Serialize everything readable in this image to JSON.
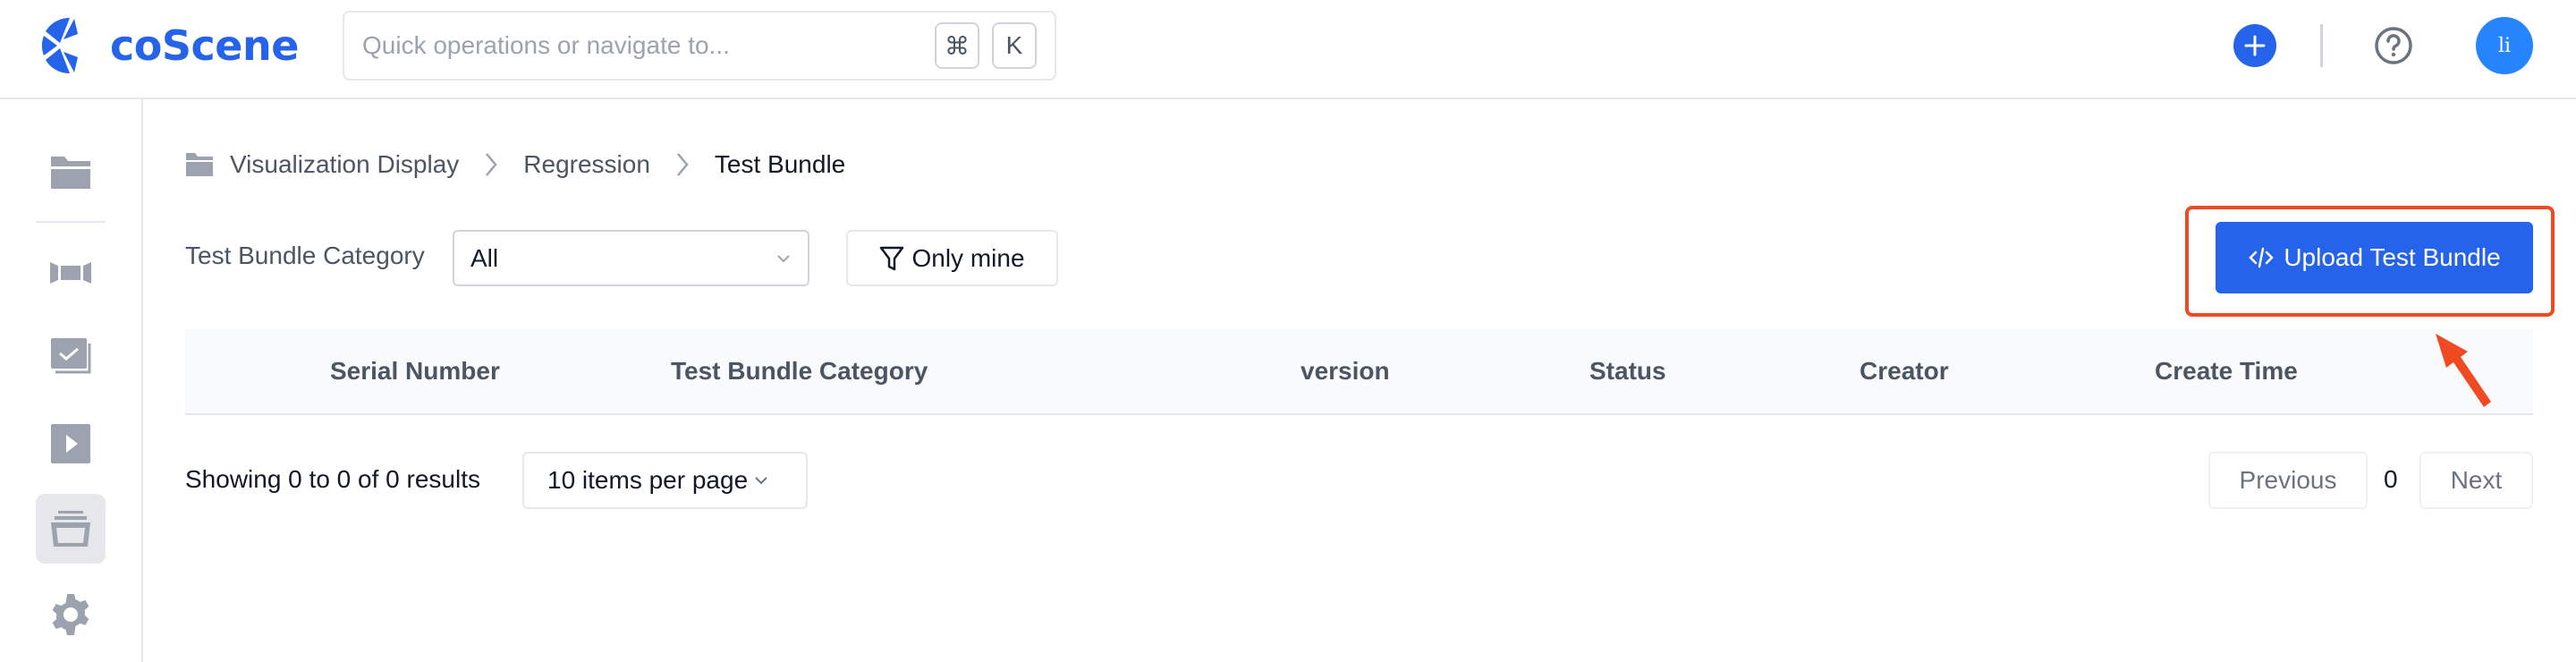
{
  "header": {
    "logo_text": "coScene",
    "search": {
      "placeholder": "Quick operations or navigate to...",
      "shortcut_keys": [
        "⌘",
        "K"
      ]
    },
    "avatar_initials": "li",
    "icons": {
      "create": "plus-icon",
      "help": "help-circle-icon"
    }
  },
  "sidebar": {
    "items": [
      {
        "name": "projects",
        "icon": "folder-icon",
        "active": false
      },
      {
        "name": "viz",
        "icon": "panorama-icon",
        "active": false
      },
      {
        "name": "tasks",
        "icon": "task-check-icon",
        "active": false
      },
      {
        "name": "playback",
        "icon": "play-icon",
        "active": false
      },
      {
        "name": "regression",
        "icon": "archive-icon",
        "active": true
      },
      {
        "name": "settings",
        "icon": "gear-icon",
        "active": false
      }
    ]
  },
  "breadcrumb": {
    "items": [
      "Visualization Display",
      "Regression",
      "Test Bundle"
    ]
  },
  "filters": {
    "category_label": "Test Bundle Category",
    "category_value": "All",
    "only_mine_label": "Only mine"
  },
  "actions": {
    "upload_label": "Upload Test Bundle",
    "highlight_color": "#f04a23",
    "primary_color": "#2563eb"
  },
  "table": {
    "columns": [
      "Serial Number",
      "Test Bundle Category",
      "version",
      "Status",
      "Creator",
      "Create Time"
    ],
    "rows": []
  },
  "pagination": {
    "summary": "Showing 0 to 0 of 0 results",
    "per_page": "10 items per page",
    "previous_label": "Previous",
    "current_page": "0",
    "next_label": "Next"
  }
}
